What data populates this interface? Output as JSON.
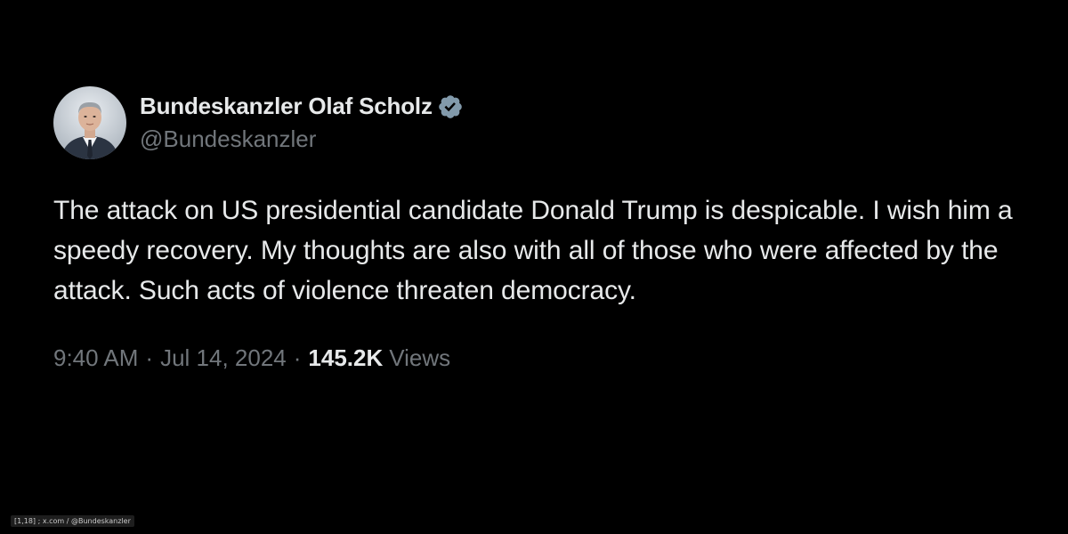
{
  "colors": {
    "background": "#000000",
    "text_primary": "#e7e9ea",
    "text_secondary": "#71767b",
    "verified_badge": "#829aab"
  },
  "author": {
    "display_name": "Bundeskanzler Olaf Scholz",
    "handle": "@Bundeskanzler",
    "verified_icon": "verified-badge-icon",
    "avatar_icon": "profile-photo"
  },
  "tweet": {
    "text": "The attack on US presidential candidate Donald Trump is despicable. I wish him a speedy recovery. My thoughts are also with all of those who were affected by the attack. Such acts of violence threaten democracy."
  },
  "meta": {
    "time": "9:40 AM",
    "separator": "·",
    "date": "Jul 14, 2024",
    "views_count": "145.2K",
    "views_label": "Views"
  },
  "footer": {
    "source": "[1,18] ; x.com / @Bundeskanzler"
  }
}
